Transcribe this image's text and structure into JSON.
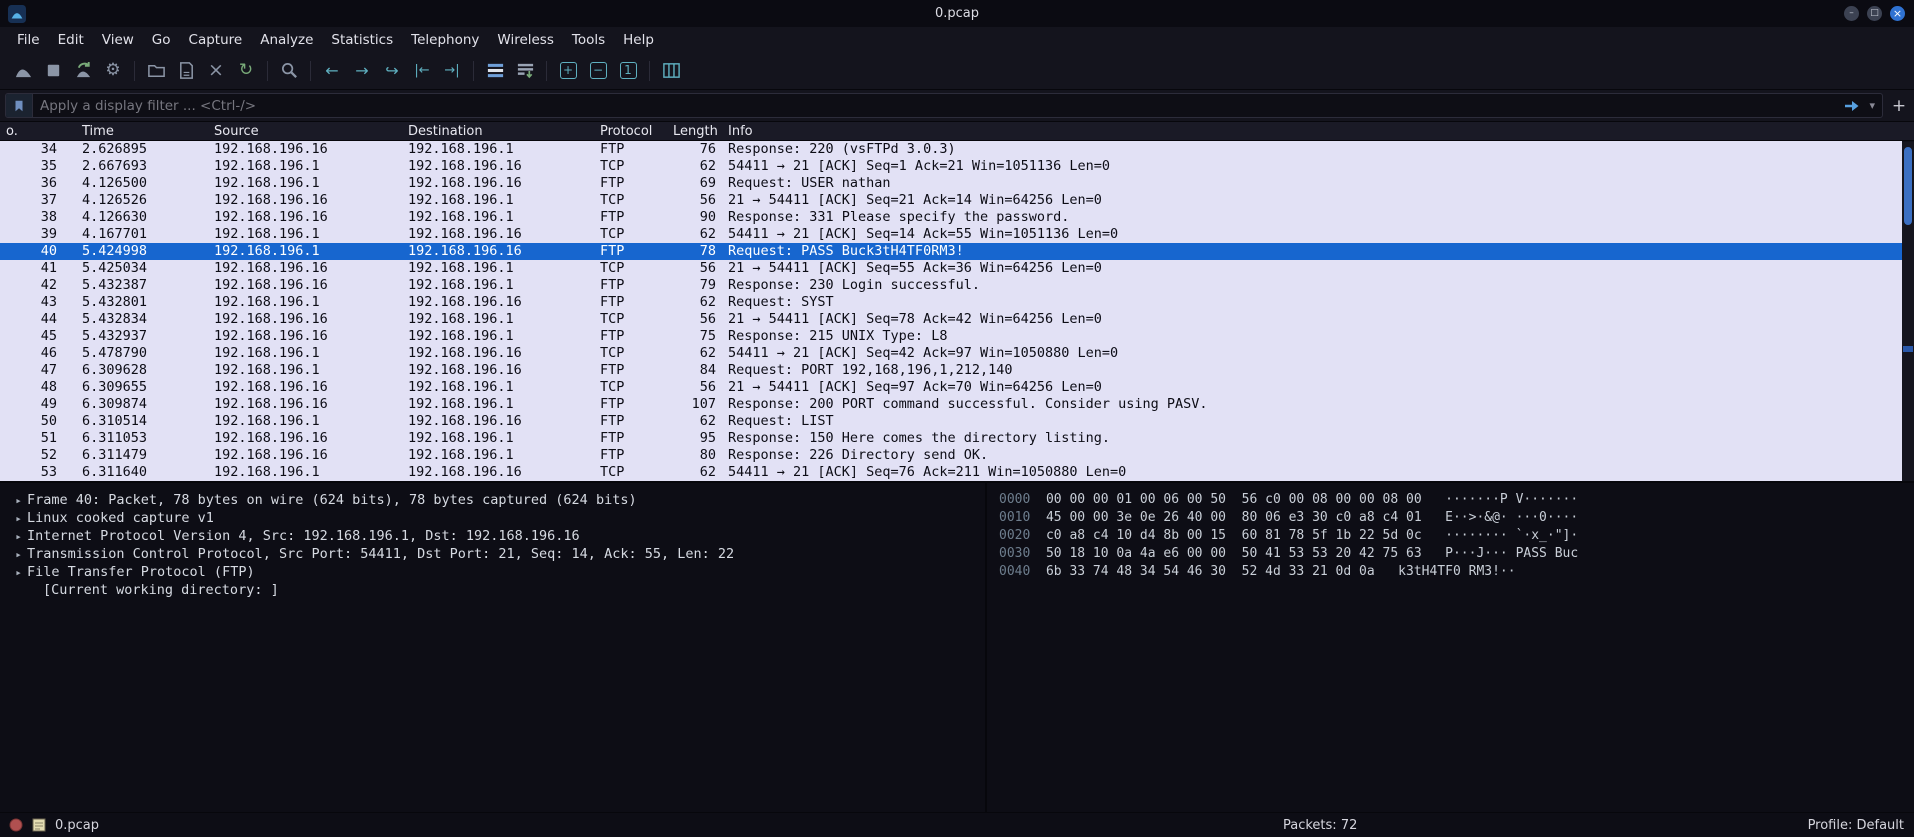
{
  "window": {
    "title": "0.pcap"
  },
  "menu": {
    "items": [
      "File",
      "Edit",
      "View",
      "Go",
      "Capture",
      "Analyze",
      "Statistics",
      "Telephony",
      "Wireless",
      "Tools",
      "Help"
    ]
  },
  "toolbar": {
    "groups": [
      [
        "start-capture",
        "stop-capture",
        "restart-capture",
        "capture-options"
      ],
      [
        "open-file",
        "save-file",
        "close-file",
        "reload-file"
      ],
      [
        "find-packet"
      ],
      [
        "go-back",
        "go-forward",
        "go-to-packet",
        "go-first",
        "go-last"
      ],
      [
        "colorize-packets",
        "auto-scroll"
      ],
      [
        "zoom-in",
        "zoom-out",
        "zoom-original"
      ],
      [
        "resize-columns"
      ]
    ]
  },
  "filter": {
    "placeholder": "Apply a display filter ... <Ctrl-/>",
    "add_button_label": "+"
  },
  "packet_list": {
    "columns": [
      "o.",
      "Time",
      "Source",
      "Destination",
      "Protocol",
      "Length",
      "Info"
    ],
    "selected_no": "40",
    "rows": [
      {
        "no": "34",
        "time": "2.626895",
        "source": "192.168.196.16",
        "destination": "192.168.196.1",
        "protocol": "FTP",
        "length": "76",
        "info": "Response: 220 (vsFTPd 3.0.3)",
        "selected": false
      },
      {
        "no": "35",
        "time": "2.667693",
        "source": "192.168.196.1",
        "destination": "192.168.196.16",
        "protocol": "TCP",
        "length": "62",
        "info": "54411 → 21 [ACK] Seq=1 Ack=21 Win=1051136 Len=0",
        "selected": false
      },
      {
        "no": "36",
        "time": "4.126500",
        "source": "192.168.196.1",
        "destination": "192.168.196.16",
        "protocol": "FTP",
        "length": "69",
        "info": "Request: USER nathan",
        "selected": false
      },
      {
        "no": "37",
        "time": "4.126526",
        "source": "192.168.196.16",
        "destination": "192.168.196.1",
        "protocol": "TCP",
        "length": "56",
        "info": "21 → 54411 [ACK] Seq=21 Ack=14 Win=64256 Len=0",
        "selected": false
      },
      {
        "no": "38",
        "time": "4.126630",
        "source": "192.168.196.16",
        "destination": "192.168.196.1",
        "protocol": "FTP",
        "length": "90",
        "info": "Response: 331 Please specify the password.",
        "selected": false
      },
      {
        "no": "39",
        "time": "4.167701",
        "source": "192.168.196.1",
        "destination": "192.168.196.16",
        "protocol": "TCP",
        "length": "62",
        "info": "54411 → 21 [ACK] Seq=14 Ack=55 Win=1051136 Len=0",
        "selected": false
      },
      {
        "no": "40",
        "time": "5.424998",
        "source": "192.168.196.1",
        "destination": "192.168.196.16",
        "protocol": "FTP",
        "length": "78",
        "info": "Request: PASS Buck3tH4TF0RM3!",
        "selected": true
      },
      {
        "no": "41",
        "time": "5.425034",
        "source": "192.168.196.16",
        "destination": "192.168.196.1",
        "protocol": "TCP",
        "length": "56",
        "info": "21 → 54411 [ACK] Seq=55 Ack=36 Win=64256 Len=0",
        "selected": false
      },
      {
        "no": "42",
        "time": "5.432387",
        "source": "192.168.196.16",
        "destination": "192.168.196.1",
        "protocol": "FTP",
        "length": "79",
        "info": "Response: 230 Login successful.",
        "selected": false
      },
      {
        "no": "43",
        "time": "5.432801",
        "source": "192.168.196.1",
        "destination": "192.168.196.16",
        "protocol": "FTP",
        "length": "62",
        "info": "Request: SYST",
        "selected": false
      },
      {
        "no": "44",
        "time": "5.432834",
        "source": "192.168.196.16",
        "destination": "192.168.196.1",
        "protocol": "TCP",
        "length": "56",
        "info": "21 → 54411 [ACK] Seq=78 Ack=42 Win=64256 Len=0",
        "selected": false
      },
      {
        "no": "45",
        "time": "5.432937",
        "source": "192.168.196.16",
        "destination": "192.168.196.1",
        "protocol": "FTP",
        "length": "75",
        "info": "Response: 215 UNIX Type: L8",
        "selected": false
      },
      {
        "no": "46",
        "time": "5.478790",
        "source": "192.168.196.1",
        "destination": "192.168.196.16",
        "protocol": "TCP",
        "length": "62",
        "info": "54411 → 21 [ACK] Seq=42 Ack=97 Win=1050880 Len=0",
        "selected": false
      },
      {
        "no": "47",
        "time": "6.309628",
        "source": "192.168.196.1",
        "destination": "192.168.196.16",
        "protocol": "FTP",
        "length": "84",
        "info": "Request: PORT 192,168,196,1,212,140",
        "selected": false
      },
      {
        "no": "48",
        "time": "6.309655",
        "source": "192.168.196.16",
        "destination": "192.168.196.1",
        "protocol": "TCP",
        "length": "56",
        "info": "21 → 54411 [ACK] Seq=97 Ack=70 Win=64256 Len=0",
        "selected": false
      },
      {
        "no": "49",
        "time": "6.309874",
        "source": "192.168.196.16",
        "destination": "192.168.196.1",
        "protocol": "FTP",
        "length": "107",
        "info": "Response: 200 PORT command successful. Consider using PASV.",
        "selected": false
      },
      {
        "no": "50",
        "time": "6.310514",
        "source": "192.168.196.1",
        "destination": "192.168.196.16",
        "protocol": "FTP",
        "length": "62",
        "info": "Request: LIST",
        "selected": false
      },
      {
        "no": "51",
        "time": "6.311053",
        "source": "192.168.196.16",
        "destination": "192.168.196.1",
        "protocol": "FTP",
        "length": "95",
        "info": "Response: 150 Here comes the directory listing.",
        "selected": false
      },
      {
        "no": "52",
        "time": "6.311479",
        "source": "192.168.196.16",
        "destination": "192.168.196.1",
        "protocol": "FTP",
        "length": "80",
        "info": "Response: 226 Directory send OK.",
        "selected": false
      },
      {
        "no": "53",
        "time": "6.311640",
        "source": "192.168.196.1",
        "destination": "192.168.196.16",
        "protocol": "TCP",
        "length": "62",
        "info": "54411 → 21 [ACK] Seq=76 Ack=211 Win=1050880 Len=0",
        "selected": false
      }
    ]
  },
  "details": {
    "lines": [
      {
        "expandable": true,
        "indent": 0,
        "text": "Frame 40: Packet, 78 bytes on wire (624 bits), 78 bytes captured (624 bits)"
      },
      {
        "expandable": true,
        "indent": 0,
        "text": "Linux cooked capture v1"
      },
      {
        "expandable": true,
        "indent": 0,
        "text": "Internet Protocol Version 4, Src: 192.168.196.1, Dst: 192.168.196.16"
      },
      {
        "expandable": true,
        "indent": 0,
        "text": "Transmission Control Protocol, Src Port: 54411, Dst Port: 21, Seq: 14, Ack: 55, Len: 22"
      },
      {
        "expandable": true,
        "indent": 0,
        "text": "File Transfer Protocol (FTP)"
      },
      {
        "expandable": false,
        "indent": 1,
        "text": "[Current working directory: ]"
      }
    ]
  },
  "hex": {
    "lines": [
      {
        "offset": "0000",
        "hex_left": "00 00 00 01 00 06 00 50",
        "hex_right": "56 c0 00 08 00 00 08 00",
        "ascii_left": "·······P",
        "ascii_right": "V·······"
      },
      {
        "offset": "0010",
        "hex_left": "45 00 00 3e 0e 26 40 00",
        "hex_right": "80 06 e3 30 c0 a8 c4 01",
        "ascii_left": "E··>·&@·",
        "ascii_right": "···0····"
      },
      {
        "offset": "0020",
        "hex_left": "c0 a8 c4 10 d4 8b 00 15",
        "hex_right": "60 81 78 5f 1b 22 5d 0c",
        "ascii_left": "········",
        "ascii_right": "`·x_·\"]·"
      },
      {
        "offset": "0030",
        "hex_left": "50 18 10 0a 4a e6 00 00",
        "hex_right": "50 41 53 53 20 42 75 63",
        "ascii_left": "P···J···",
        "ascii_right": "PASS Buc"
      },
      {
        "offset": "0040",
        "hex_left": "6b 33 74 48 34 54 46 30",
        "hex_right": "52 4d 33 21 0d 0a",
        "ascii_left": "k3tH4TF0",
        "ascii_right": "RM3!··"
      }
    ]
  },
  "status": {
    "file": "0.pcap",
    "packets": "Packets: 72",
    "profile": "Profile: Default"
  },
  "colors": {
    "accent_blue": "#2f72d2",
    "row_bg": "#e2e1f5",
    "selected_row_bg": "#1766cf",
    "scrollbar_thumb": "#3b6fc2"
  }
}
